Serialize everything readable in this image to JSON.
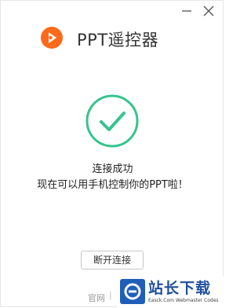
{
  "window": {
    "title": "PPT遥控器",
    "controls": {
      "minimize_icon": "minimize-icon",
      "close_icon": "close-icon"
    }
  },
  "status": {
    "icon": "checkmark-circle-icon",
    "title": "连接成功",
    "message": "现在可以用手机控制你的PPT啦！"
  },
  "actions": {
    "disconnect_label": "断开连接"
  },
  "footer": {
    "official_site": "官网"
  },
  "watermark": {
    "title": "站长下载",
    "subtitle": "Easck.Com Webmaster Codes"
  },
  "colors": {
    "accent": "#36c48e",
    "brand": "#ff6a1a"
  }
}
